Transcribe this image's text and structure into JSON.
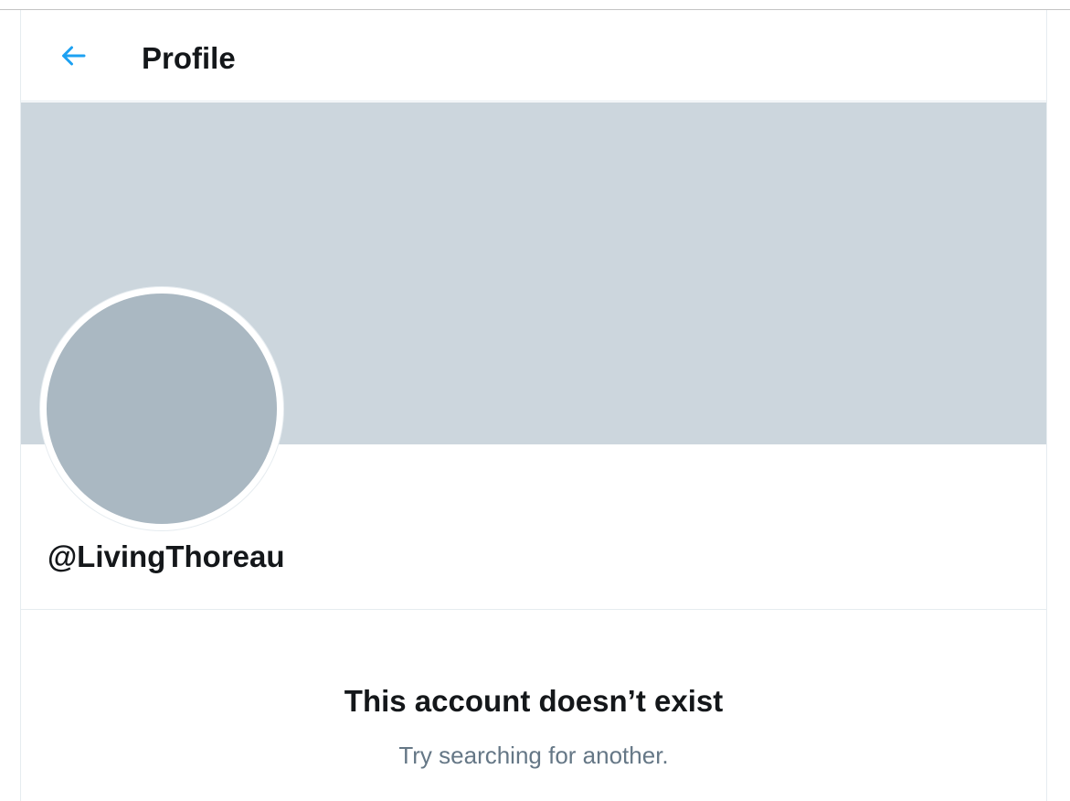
{
  "header": {
    "back_icon": "arrow-left-icon",
    "title": "Profile"
  },
  "profile": {
    "handle": "@LivingThoreau"
  },
  "empty_state": {
    "title": "This account doesn’t exist",
    "subtitle": "Try searching for another."
  },
  "colors": {
    "accent": "#1da1f2",
    "banner": "#ccd6dd",
    "avatar": "#aab8c2",
    "primary_text": "#14171a",
    "secondary_text": "#657786"
  }
}
